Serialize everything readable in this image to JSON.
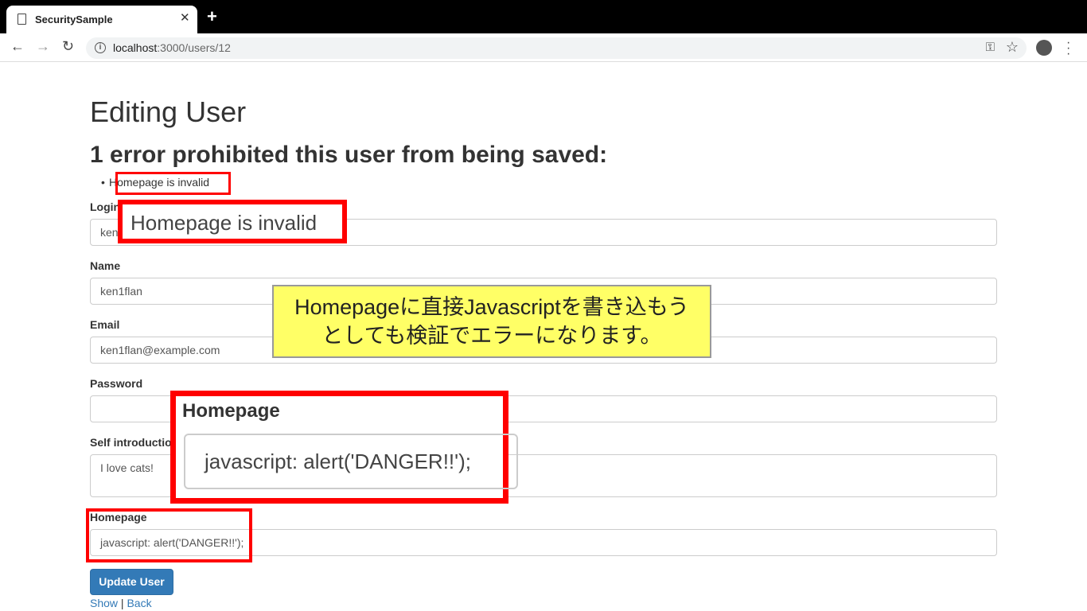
{
  "browser": {
    "tab_title": "SecuritySample",
    "tab_close": "✕",
    "new_tab": "+",
    "url_host": "localhost",
    "url_path": ":3000/users/12"
  },
  "page": {
    "title": "Editing User",
    "error_heading": "1 error prohibited this user from being saved:",
    "errors": [
      "Homepage is invalid"
    ]
  },
  "form": {
    "login": {
      "label": "Login",
      "value": "ken"
    },
    "name": {
      "label": "Name",
      "value": "ken1flan"
    },
    "email": {
      "label": "Email",
      "value": "ken1flan@example.com"
    },
    "password": {
      "label": "Password",
      "value": ""
    },
    "self_introduction": {
      "label": "Self introductio",
      "value": "I love cats!"
    },
    "homepage": {
      "label": "Homepage",
      "value": "javascript: alert('DANGER!!');"
    },
    "submit_label": "Update User"
  },
  "links": {
    "show": "Show",
    "separator": "|",
    "back": "Back"
  },
  "annotations": {
    "zoom_error": "Homepage is invalid",
    "callout_line1": "Homepageに直接Javascriptを書き込もう",
    "callout_line2": "としても検証でエラーになります。",
    "zoom_label": "Homepage",
    "zoom_value": "javascript: alert('DANGER!!');"
  }
}
